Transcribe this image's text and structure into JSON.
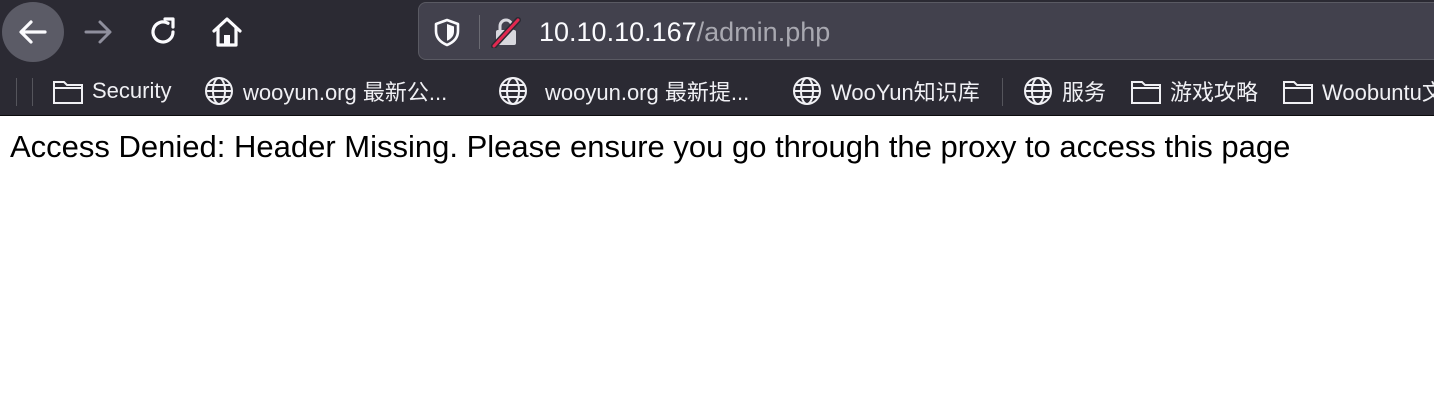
{
  "toolbar": {
    "back_icon": "arrow-left-icon",
    "forward_icon": "arrow-right-icon",
    "reload_icon": "reload-icon",
    "home_icon": "home-icon"
  },
  "urlbar": {
    "host": "10.10.10.167",
    "path": "/admin.php",
    "shield_icon": "tracking-shield-icon",
    "lock_icon": "insecure-lock-icon"
  },
  "bookmarks": [
    {
      "label": "Security",
      "icon": "folder-icon"
    },
    {
      "label": "wooyun.org 最新公...",
      "icon": "globe-icon"
    },
    {
      "label": "wooyun.org 最新提...",
      "icon": "globe-icon"
    },
    {
      "label": "WooYun知识库",
      "icon": "globe-icon"
    },
    {
      "label": "服务",
      "icon": "globe-icon"
    },
    {
      "label": "游戏攻略",
      "icon": "folder-icon"
    },
    {
      "label": "Woobuntu文",
      "icon": "folder-icon"
    }
  ],
  "page": {
    "message": "Access Denied: Header Missing. Please ensure you go through the proxy to access this page"
  },
  "colors": {
    "toolbar_bg": "#2b2a33",
    "urlbar_bg": "#42414d",
    "text_light": "#fbfbfe",
    "insecure_red": "#e22850"
  }
}
